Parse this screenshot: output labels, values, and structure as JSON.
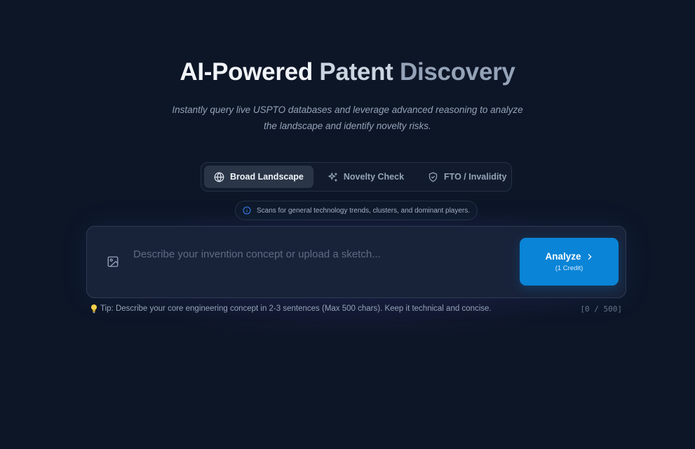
{
  "hero": {
    "title_part1": "AI-Powered",
    "title_part2": "Patent",
    "title_part3": "Discovery",
    "subtitle": "Instantly query live USPTO databases and leverage advanced reasoning to analyze the landscape and identify novelty risks."
  },
  "tabs": [
    {
      "label": "Broad Landscape",
      "icon": "globe-icon",
      "active": true
    },
    {
      "label": "Novelty Check",
      "icon": "sparkles-icon",
      "active": false
    },
    {
      "label": "FTO / Invalidity",
      "icon": "shield-icon",
      "active": false
    }
  ],
  "hint": {
    "icon": "info-icon",
    "text": "Scans for general technology trends, clusters, and dominant players."
  },
  "input": {
    "placeholder": "Describe your invention concept or upload a sketch...",
    "value": "",
    "upload_icon": "image-icon"
  },
  "analyze_button": {
    "label": "Analyze",
    "sublabel": "(1 Credit)",
    "icon": "chevron-right-icon"
  },
  "tip": {
    "icon": "lightbulb-icon",
    "text": "Tip: Describe your core engineering concept in 2-3 sentences (Max 500 chars). Keep it technical and concise."
  },
  "counter": "[0 / 500]",
  "colors": {
    "background": "#0d1627",
    "accent": "#0a84d6",
    "active_tab": "#2a3548",
    "tip_bulb": "#f5d04a"
  }
}
